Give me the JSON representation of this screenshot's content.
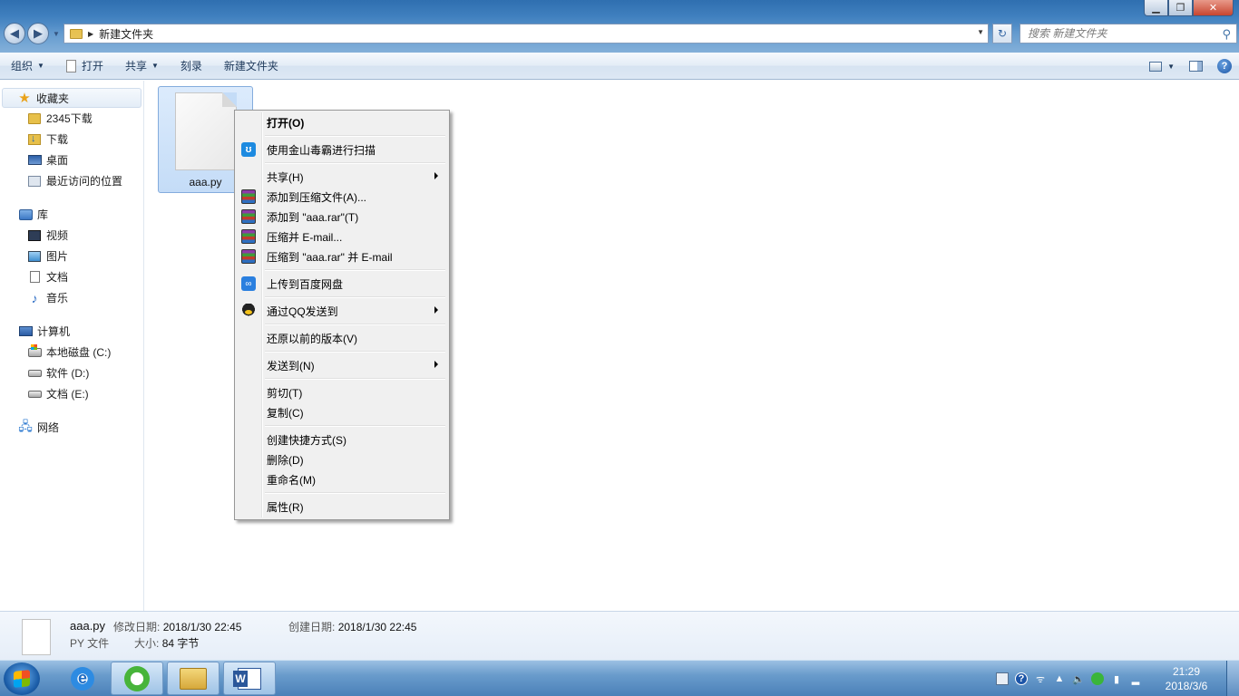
{
  "window": {
    "address_path": "新建文件夹",
    "search_placeholder": "搜索 新建文件夹",
    "buttons": {
      "minimize": "▁",
      "maximize": "❐",
      "close": "✕"
    }
  },
  "toolbar": {
    "organize": "组织",
    "open": "打开",
    "share": "共享",
    "burn": "刻录",
    "new_folder": "新建文件夹"
  },
  "navpane": {
    "favorites": {
      "label": "收藏夹",
      "items": [
        "2345下载",
        "下载",
        "桌面",
        "最近访问的位置"
      ]
    },
    "libraries": {
      "label": "库",
      "items": [
        "视频",
        "图片",
        "文档",
        "音乐"
      ]
    },
    "computer": {
      "label": "计算机",
      "items": [
        "本地磁盘 (C:)",
        "软件 (D:)",
        "文档 (E:)"
      ]
    },
    "network": {
      "label": "网络"
    }
  },
  "content": {
    "file": {
      "name": "aaa.py"
    }
  },
  "context_menu": {
    "open": "打开(O)",
    "scan": "使用金山毒霸进行扫描",
    "share": "共享(H)",
    "add_archive": "添加到压缩文件(A)...",
    "add_rar": "添加到 \"aaa.rar\"(T)",
    "compress_email": "压缩并 E-mail...",
    "compress_rar_email": "压缩到 \"aaa.rar\" 并 E-mail",
    "baidu": "上传到百度网盘",
    "qq": "通过QQ发送到",
    "restore": "还原以前的版本(V)",
    "send_to": "发送到(N)",
    "cut": "剪切(T)",
    "copy": "复制(C)",
    "shortcut": "创建快捷方式(S)",
    "delete": "删除(D)",
    "rename": "重命名(M)",
    "properties": "属性(R)"
  },
  "details": {
    "name": "aaa.py",
    "type": "PY 文件",
    "modified_label": "修改日期:",
    "modified": "2018/1/30 22:45",
    "size_label": "大小:",
    "size": "84 字节",
    "created_label": "创建日期:",
    "created": "2018/1/30 22:45"
  },
  "taskbar": {
    "time": "21:29",
    "date": "2018/3/6"
  }
}
